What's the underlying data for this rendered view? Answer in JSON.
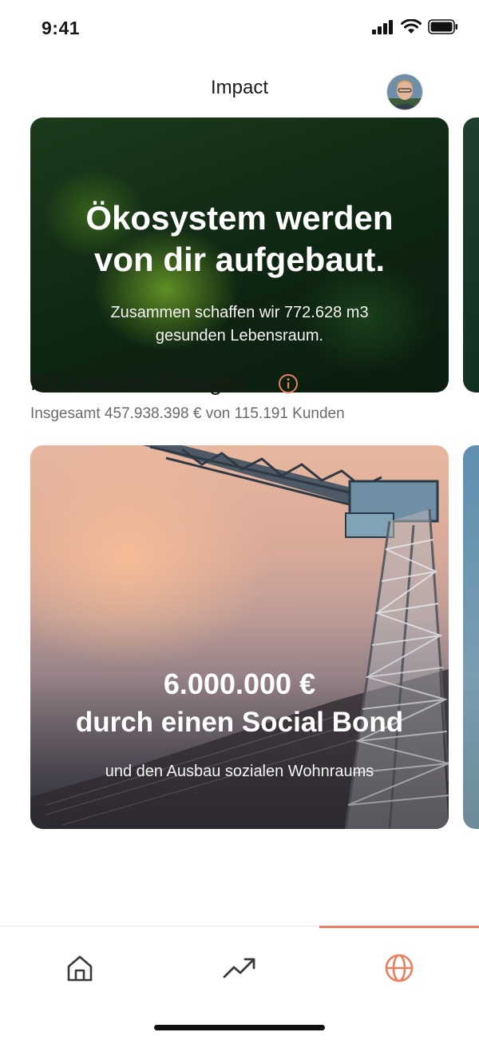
{
  "status_bar": {
    "time": "9:41"
  },
  "header": {
    "title": "Impact"
  },
  "eco_card": {
    "headline_line1": "Ökosystem werden",
    "headline_line2": "von dir aufgebaut.",
    "sub_line1": "Zusammen schaffen wir  772.628 m3",
    "sub_line2": "gesunden Lebensraum."
  },
  "deposits": {
    "title": "Mit unseren Einlagen",
    "subtitle": "Insgesamt 457.938.398 € von 115.191 Kunden"
  },
  "bond_card": {
    "amount": "6.000.000 €",
    "title": "durch einen Social Bond",
    "subtitle": "und den Ausbau sozialen Wohnraums"
  },
  "tabbar": {
    "tabs": [
      {
        "name": "home",
        "icon": "home-icon",
        "active": false
      },
      {
        "name": "trends",
        "icon": "trending-up-icon",
        "active": false
      },
      {
        "name": "impact",
        "icon": "globe-icon",
        "active": true
      }
    ]
  },
  "colors": {
    "accent": "#e8805e",
    "inactive_icon": "#3a3a3a",
    "subtext": "#6b6b6b"
  }
}
